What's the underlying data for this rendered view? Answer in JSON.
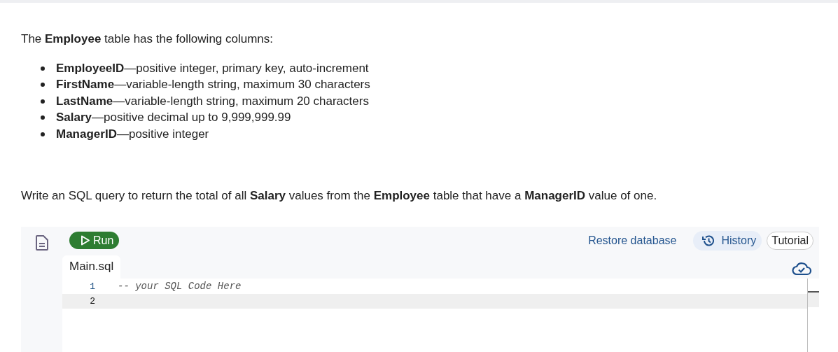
{
  "intro": "The **Employee** table has the following columns:",
  "columns": [
    "**EmployeeID**—positive integer, primary key, auto-increment",
    "**FirstName**—variable-length string, maximum 30 characters",
    "**LastName**—variable-length string, maximum 20 characters",
    "**Salary**—positive decimal up to 9,999,999.99",
    "**ManagerID**—positive integer"
  ],
  "question": "Write an SQL query to return the total of all **Salary** values from the **Employee** table that have a **ManagerID** value of one.",
  "editor": {
    "run_button": "Run",
    "restore_link": "Restore database",
    "history_button": "History",
    "tutorial_button": "Tutorial",
    "tabs": [
      {
        "label": "Main.sql",
        "selected": true
      }
    ],
    "lines": [
      {
        "number": "1",
        "code": "-- your SQL Code Here",
        "current": false
      },
      {
        "number": "2",
        "current": true
      }
    ]
  }
}
